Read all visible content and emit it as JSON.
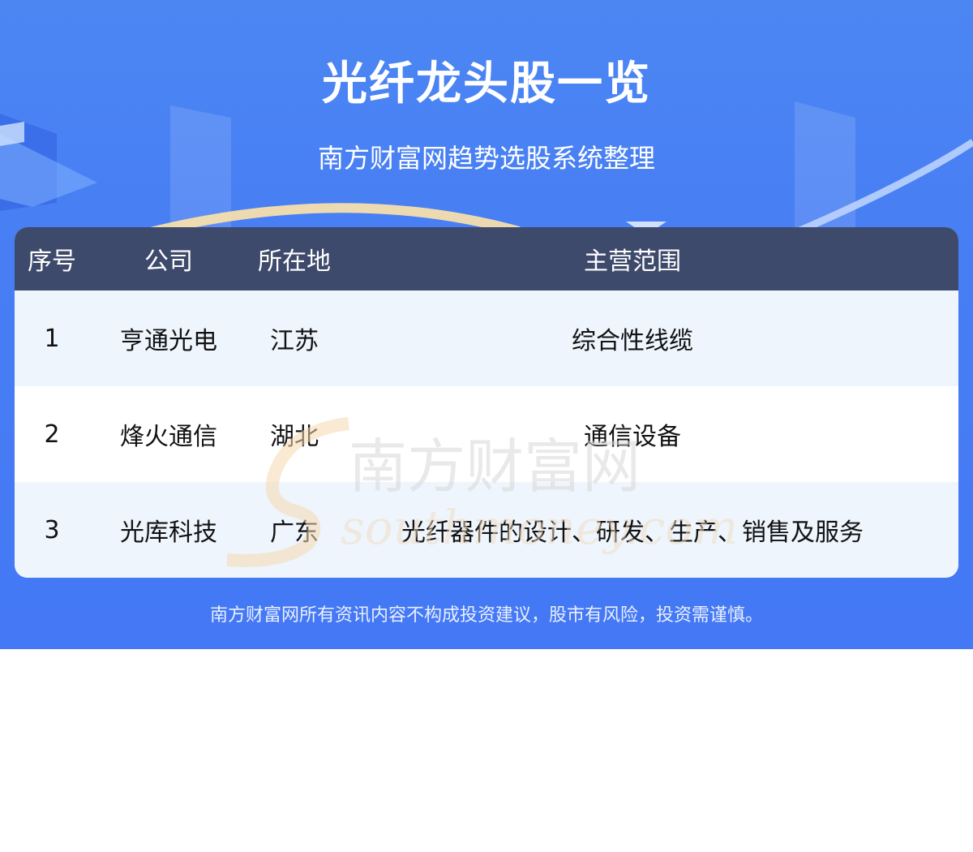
{
  "header": {
    "title": "光纤龙头股一览",
    "subtitle": "南方财富网趋势选股系统整理"
  },
  "table": {
    "columns": [
      "序号",
      "公司",
      "所在地",
      "主营范围"
    ],
    "rows": [
      {
        "no": "1",
        "company": "亨通光电",
        "location": "江苏",
        "business": "综合性线缆"
      },
      {
        "no": "2",
        "company": "烽火通信",
        "location": "湖北",
        "business": "通信设备"
      },
      {
        "no": "3",
        "company": "光库科技",
        "location": "广东",
        "business": "光纤器件的设计、研发、生产、销售及服务"
      }
    ]
  },
  "watermark": {
    "cn": "南方财富网",
    "en": "southmoney.com"
  },
  "footer": {
    "disclaimer": "南方财富网所有资讯内容不构成投资建议，股市有风险，投资需谨慎。"
  },
  "colors": {
    "banner": "#4478f5",
    "table_header": "#3e4a6b",
    "row_alt": "#eef5fd"
  }
}
